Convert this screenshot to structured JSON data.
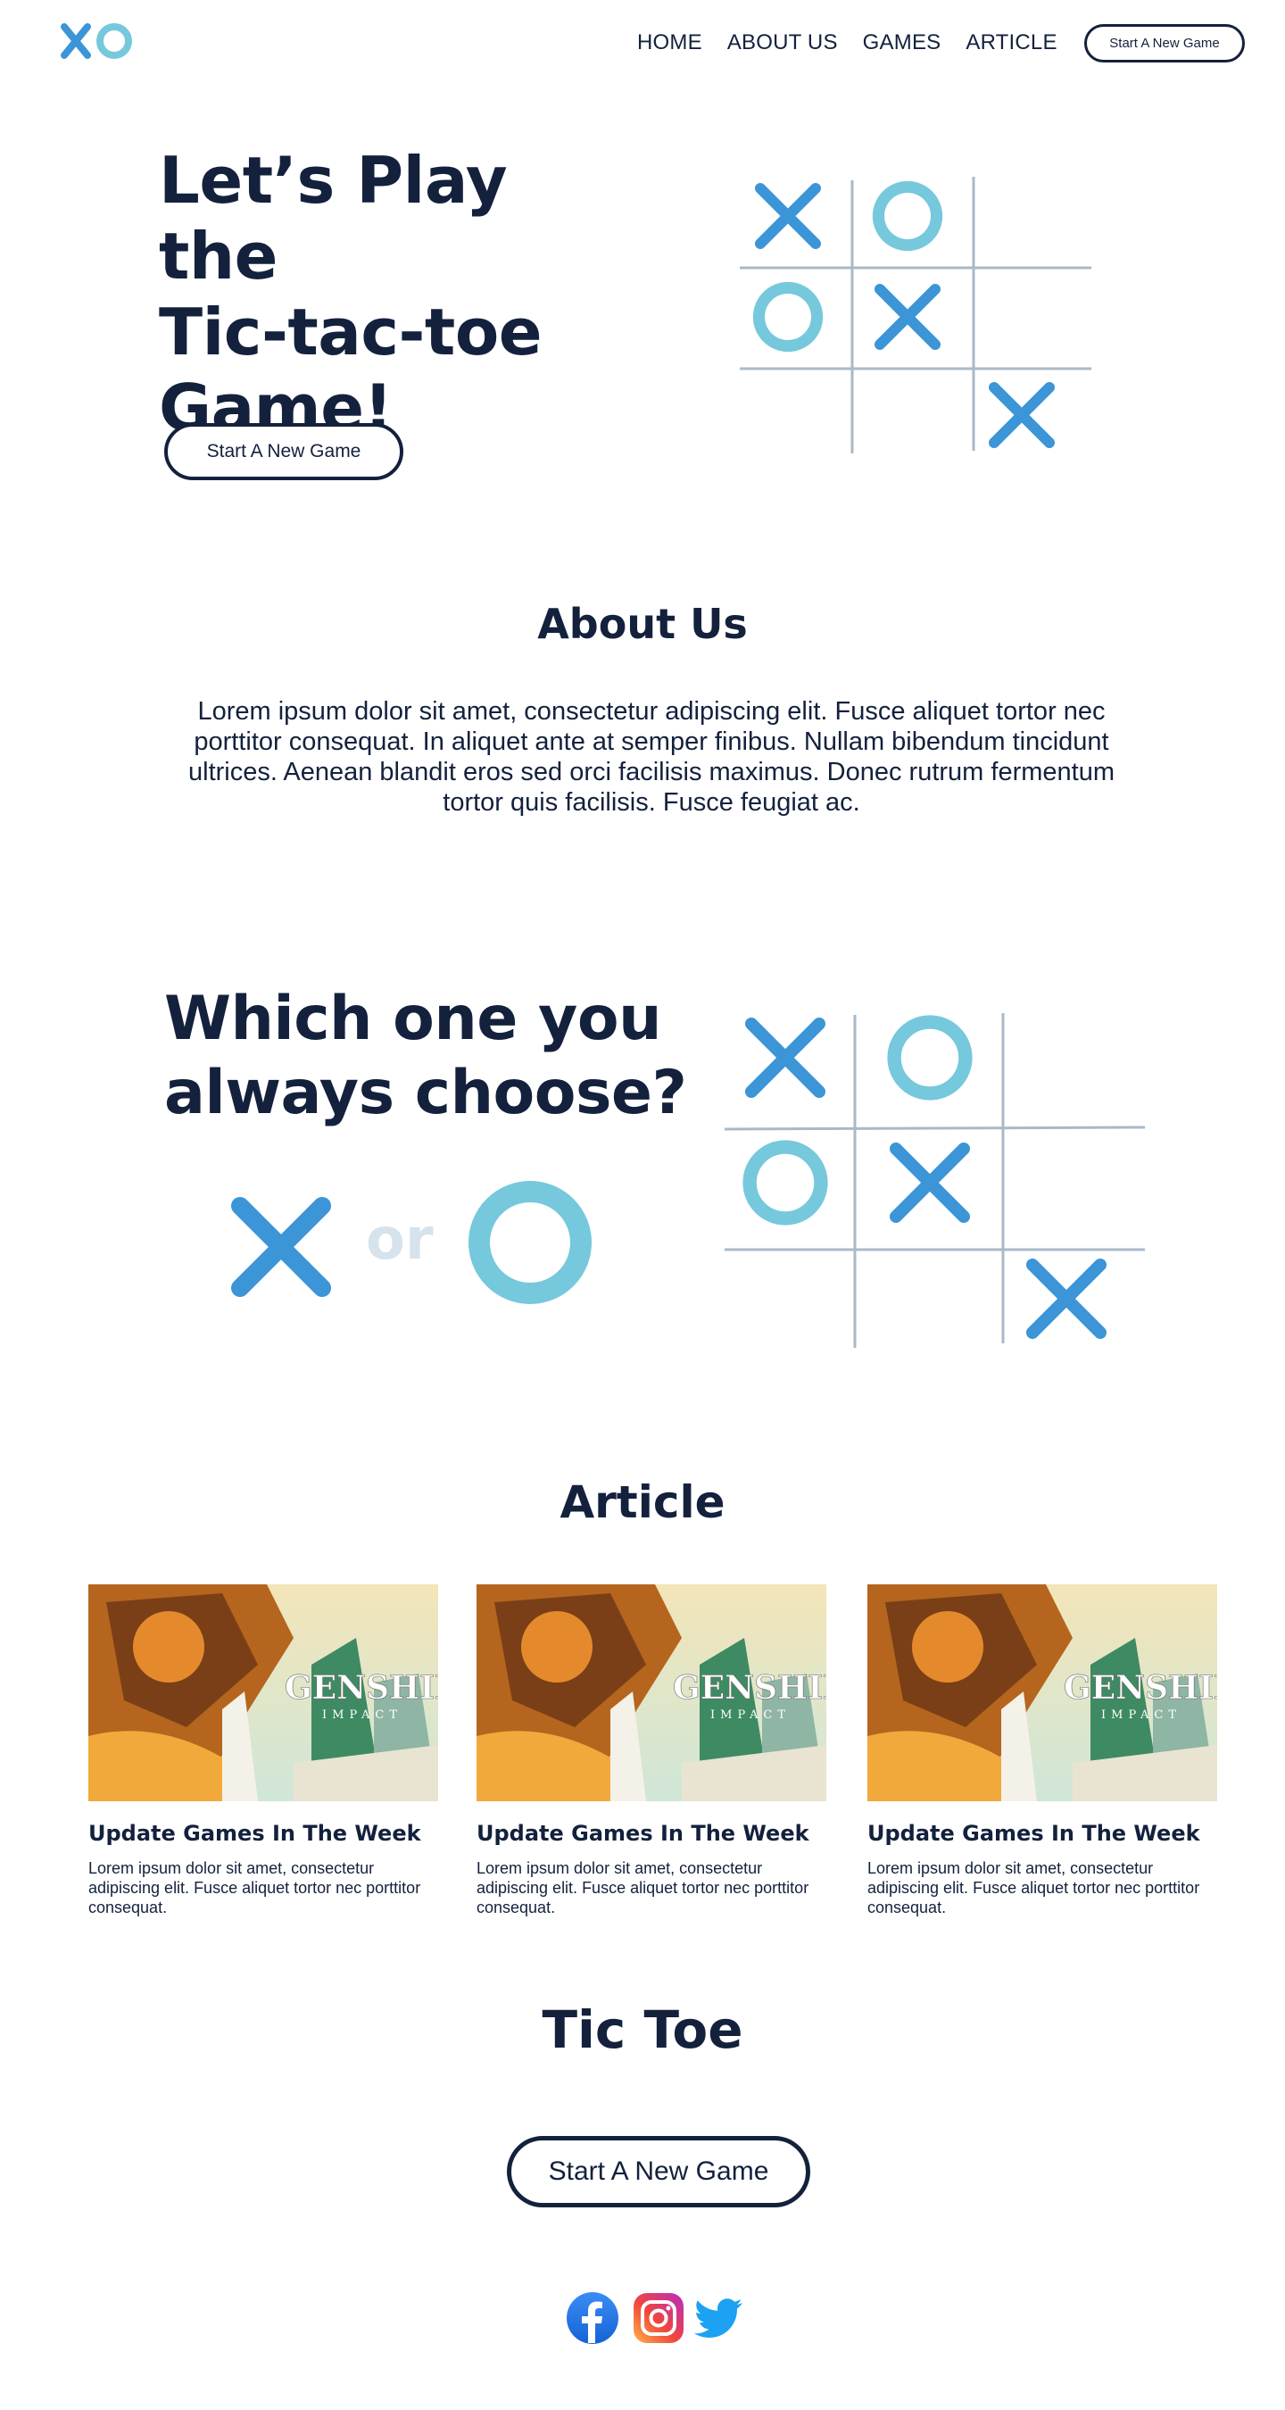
{
  "header": {
    "logo_icon": "xo-logo-icon",
    "nav": [
      {
        "label": "HOME"
      },
      {
        "label": "ABOUT US"
      },
      {
        "label": "GAMES"
      },
      {
        "label": "ARTICLE"
      }
    ],
    "cta_label": "Start A New Game"
  },
  "hero": {
    "title_line1": "Let’s Play the",
    "title_line2": "Tic-tac-toe",
    "title_line3": "Game!",
    "cta_label": "Start A New Game",
    "board": [
      [
        "X",
        "O",
        ""
      ],
      [
        "O",
        "X",
        ""
      ],
      [
        "",
        "",
        "X"
      ]
    ]
  },
  "about": {
    "title": "About Us",
    "text": "Lorem ipsum dolor sit amet, consectetur adipiscing elit. Fusce aliquet tortor nec porttitor consequat. In aliquet ante at semper finibus. Nullam bibendum tincidunt ultrices. Aenean blandit eros sed orci facilisis maximus. Donec rutrum fermentum tortor quis facilisis. Fusce feugiat ac."
  },
  "choose": {
    "title_line1": "Which one you",
    "title_line2": "always choose?",
    "or_label": "or",
    "board": [
      [
        "X",
        "O",
        ""
      ],
      [
        "O",
        "X",
        ""
      ],
      [
        "",
        "",
        "X"
      ]
    ]
  },
  "articles": {
    "title": "Article",
    "image_title": "GENSHIN",
    "image_subtitle": "IMPACT",
    "items": [
      {
        "title": "Update Games In The Week",
        "text": "Lorem ipsum dolor sit amet, consectetur adipiscing elit. Fusce aliquet tortor nec porttitor consequat."
      },
      {
        "title": "Update Games In The Week",
        "text": "Lorem ipsum dolor sit amet, consectetur adipiscing elit. Fusce aliquet tortor nec porttitor consequat."
      },
      {
        "title": "Update Games In The Week",
        "text": "Lorem ipsum dolor sit amet, consectetur adipiscing elit. Fusce aliquet tortor nec porttitor consequat."
      }
    ]
  },
  "footer": {
    "title": "Tic Toe",
    "cta_label": "Start A New Game",
    "social": [
      "facebook-icon",
      "instagram-icon",
      "twitter-icon"
    ]
  },
  "colors": {
    "navy": "#14213d",
    "x_blue": "#3b95d6",
    "o_cyan": "#76c8dc",
    "grid": "#a9b9c8",
    "or_grey": "#d6e3ec"
  }
}
